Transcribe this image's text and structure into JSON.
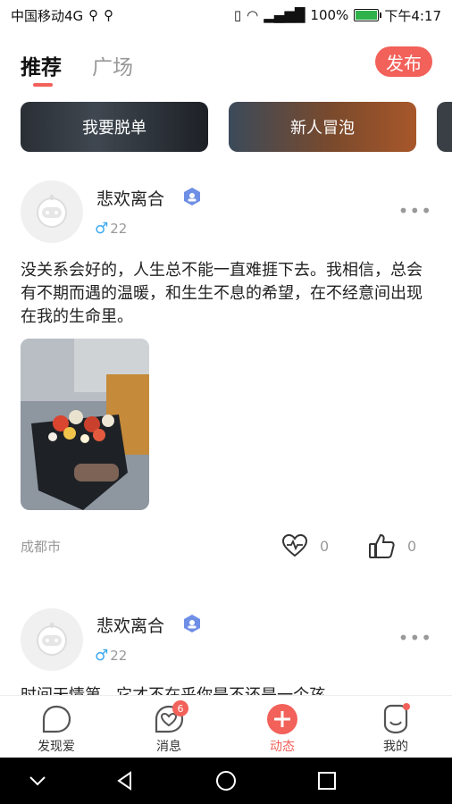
{
  "status_bar": {
    "carrier": "中国移动4G",
    "battery": "100%",
    "time": "下午4:17"
  },
  "tabs": {
    "recommend": "推荐",
    "plaza": "广场"
  },
  "publish_label": "发布",
  "banners": [
    {
      "label": "我要脱单"
    },
    {
      "label": "新人冒泡"
    }
  ],
  "posts": [
    {
      "username": "悲欢离合",
      "age": "22",
      "content": "没关系会好的，人生总不能一直难捱下去。我相信，总会有不期而遇的温暖，和生生不息的希望，在不经意间出现在我的生命里。",
      "location": "成都市",
      "likes": "0",
      "thumbs": "0"
    },
    {
      "username": "悲欢离合",
      "age": "22",
      "content": "时间天情第...它才不在乎你是不还是一个孩"
    }
  ],
  "bottom_nav": [
    {
      "label": "发现爱"
    },
    {
      "label": "消息",
      "badge": "6"
    },
    {
      "label": "动态"
    },
    {
      "label": "我的"
    }
  ],
  "colors": {
    "accent": "#f2615a",
    "male_blue": "#3aa8f0",
    "verify_blue": "#6f8fe6"
  }
}
